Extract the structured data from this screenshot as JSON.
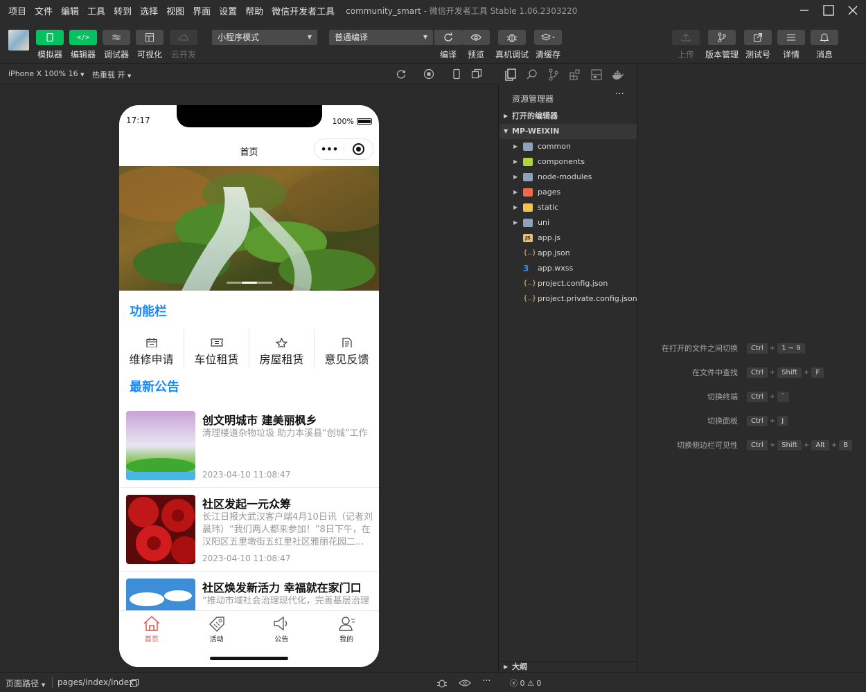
{
  "menubar": {
    "items": [
      "项目",
      "文件",
      "编辑",
      "工具",
      "转到",
      "选择",
      "视图",
      "界面",
      "设置",
      "帮助",
      "微信开发者工具"
    ],
    "project": "community_smart",
    "separator": " - ",
    "app_title": "微信开发者工具 Stable 1.06.2303220"
  },
  "toolbar": {
    "simulator": "模拟器",
    "editor": "编辑器",
    "debugger": "调试器",
    "visualize": "可视化",
    "cloud": "云开发",
    "mode_select": "小程序模式",
    "compile_select": "普通编译",
    "compile": "编译",
    "preview": "预览",
    "remote_debug": "真机调试",
    "clear_cache": "清缓存",
    "upload": "上传",
    "version": "版本管理",
    "test_id": "测试号",
    "details": "详情",
    "messages": "消息"
  },
  "simbar": {
    "device": "iPhone X 100% 16",
    "hot_reload": "热重载 开"
  },
  "phone": {
    "time": "17:17",
    "battery": "100%",
    "battery_level": 1.0,
    "nav_title": "首页",
    "func_title": "功能栏",
    "funcs": [
      {
        "label": "维修申请",
        "icon": "calendar-icon"
      },
      {
        "label": "车位租赁",
        "icon": "ticket-icon"
      },
      {
        "label": "房屋租赁",
        "icon": "star-icon"
      },
      {
        "label": "意见反馈",
        "icon": "document-icon"
      }
    ],
    "notice_title": "最新公告",
    "news": [
      {
        "title": "创文明城市 建美丽枫乡",
        "desc": "清理楼道杂物垃圾 助力本溪县“创城”工作",
        "date": "2023-04-10 11:08:47"
      },
      {
        "title": "社区发起一元众筹",
        "desc": "长江日报大武汉客户端4月10日讯（记者刘晨玮）“我们两人都来参加！”8日下午，在汉阳区五里墩街五红里社区雅丽花园二...",
        "date": "2023-04-10 11:08:47"
      },
      {
        "title": "社区焕发新活力 幸福就在家门口",
        "desc": "“推动市域社会治理现代化，完善基层治理",
        "date": ""
      }
    ],
    "tabs": [
      {
        "label": "首页",
        "icon": "home-icon"
      },
      {
        "label": "活动",
        "icon": "tag-icon"
      },
      {
        "label": "公告",
        "icon": "speaker-icon"
      },
      {
        "label": "我的",
        "icon": "user-icon"
      }
    ]
  },
  "explorer": {
    "title": "资源管理器",
    "more": "···",
    "open_editors": "打开的编辑器",
    "root": "MP-WEIXIN",
    "items": [
      {
        "name": "common",
        "type": "folder"
      },
      {
        "name": "components",
        "type": "folder"
      },
      {
        "name": "node-modules",
        "type": "folder"
      },
      {
        "name": "pages",
        "type": "folder"
      },
      {
        "name": "static",
        "type": "folder"
      },
      {
        "name": "uni",
        "type": "folder"
      },
      {
        "name": "app.js",
        "type": "js"
      },
      {
        "name": "app.json",
        "type": "json"
      },
      {
        "name": "app.wxss",
        "type": "css"
      },
      {
        "name": "project.config.json",
        "type": "json"
      },
      {
        "name": "project.private.config.json",
        "type": "json"
      }
    ],
    "outline": "大纲"
  },
  "shortcuts": [
    {
      "label": "在打开的文件之间切换",
      "keys": [
        "Ctrl",
        "1 ~ 9"
      ]
    },
    {
      "label": "在文件中查找",
      "keys": [
        "Ctrl",
        "Shift",
        "F"
      ]
    },
    {
      "label": "切换终端",
      "keys": [
        "Ctrl",
        "`"
      ]
    },
    {
      "label": "切换面板",
      "keys": [
        "Ctrl",
        "J"
      ]
    },
    {
      "label": "切换侧边栏可见性",
      "keys": [
        "Ctrl",
        "Shift",
        "Alt",
        "B"
      ]
    }
  ],
  "status": {
    "page_path_label": "页面路径",
    "page_path": "pages/index/index",
    "errors": "0",
    "warnings": "0"
  },
  "colors": {
    "accent_green": "#07c160",
    "title_blue": "#1989fa",
    "tab_active": "#d9534f"
  }
}
